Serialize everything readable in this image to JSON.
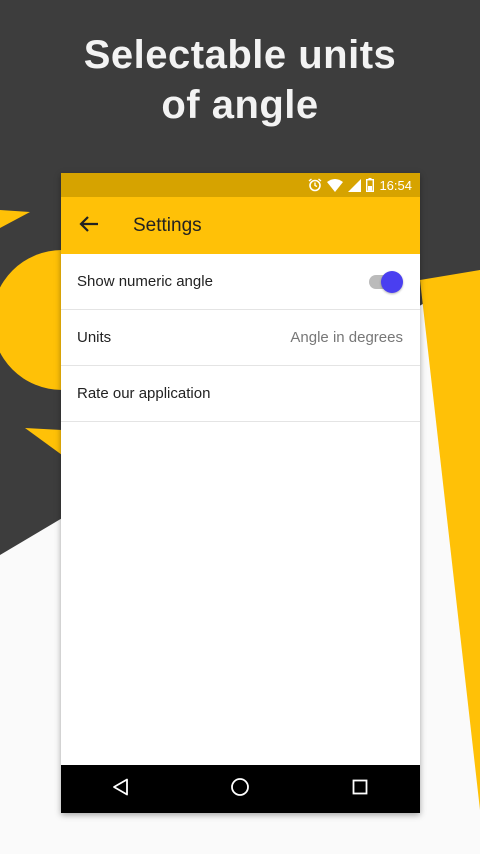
{
  "promo": {
    "headline_line1": "Selectable units",
    "headline_line2": "of angle"
  },
  "colors": {
    "dark_background": "#3d3d3d",
    "accent_yellow": "#ffc107",
    "status_bar": "#d6a300",
    "toggle_on": "#4a3ff0"
  },
  "status_bar": {
    "time": "16:54",
    "icons": [
      "alarm-icon",
      "wifi-icon",
      "signal-icon",
      "battery-icon"
    ]
  },
  "app_bar": {
    "title": "Settings",
    "back_icon": "arrow-left-icon"
  },
  "settings": {
    "show_numeric_angle": {
      "label": "Show numeric angle",
      "enabled": true
    },
    "units": {
      "label": "Units",
      "value": "Angle in degrees"
    },
    "rate": {
      "label": "Rate our application"
    }
  },
  "nav_bar": {
    "icons": [
      "back-triangle-icon",
      "home-circle-icon",
      "recents-square-icon"
    ]
  }
}
